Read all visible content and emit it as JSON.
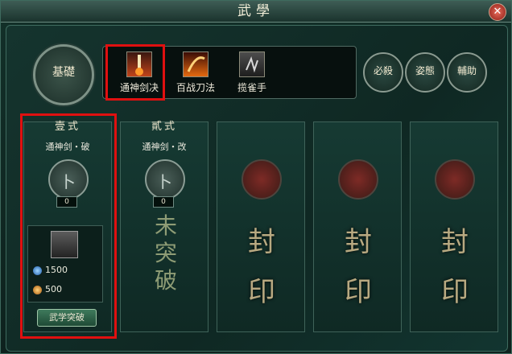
{
  "window": {
    "title": "武學",
    "close_glyph": "✕"
  },
  "style_button": {
    "label": "基礎"
  },
  "skills": [
    {
      "label": "通神剑决",
      "icon": "sword-flame-icon",
      "selected": true
    },
    {
      "label": "百战刀法",
      "icon": "blade-fire-icon",
      "selected": false
    },
    {
      "label": "揽雀手",
      "icon": "claw-hand-icon",
      "selected": false
    }
  ],
  "right_buttons": [
    {
      "label": "必殺"
    },
    {
      "label": "姿態"
    },
    {
      "label": "輔助"
    }
  ],
  "columns": [
    {
      "head": "壹式",
      "sub": "通神剑・破",
      "count": "0",
      "state": "active"
    },
    {
      "head": "貳式",
      "sub": "通神剑・改",
      "count": "0",
      "state": "unbroken",
      "text": "未突破"
    },
    {
      "head": "",
      "sub": "",
      "state": "sealed",
      "text": "封印"
    },
    {
      "head": "",
      "sub": "",
      "state": "sealed",
      "text": "封印"
    },
    {
      "head": "",
      "sub": "",
      "state": "sealed",
      "text": "封印"
    }
  ],
  "resources": {
    "spirit": "1500",
    "coin": "500"
  },
  "break_button": {
    "label": "武学突破"
  },
  "colors": {
    "selection": "#e01010",
    "panel": "#123029"
  }
}
